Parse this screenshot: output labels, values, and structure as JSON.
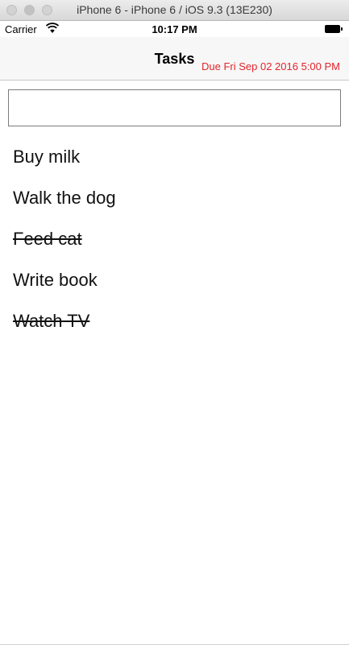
{
  "window": {
    "title": "iPhone 6 - iPhone 6 / iOS 9.3 (13E230)"
  },
  "status_bar": {
    "carrier": "Carrier",
    "time": "10:17 PM",
    "wifi_icon": "wifi-icon",
    "battery_icon": "battery-icon"
  },
  "nav": {
    "title": "Tasks"
  },
  "input": {
    "value": "",
    "placeholder": ""
  },
  "tasks": [
    {
      "label": "Buy milk",
      "completed": false,
      "due": ""
    },
    {
      "label": "Walk the dog",
      "completed": false,
      "due": "Due Fri Sep 02 2016 5:00 PM"
    },
    {
      "label": "Feed cat",
      "completed": true,
      "due": ""
    },
    {
      "label": "Write book",
      "completed": false,
      "due": ""
    },
    {
      "label": "Watch TV",
      "completed": true,
      "due": ""
    }
  ],
  "colors": {
    "due_text": "#e3242b"
  }
}
